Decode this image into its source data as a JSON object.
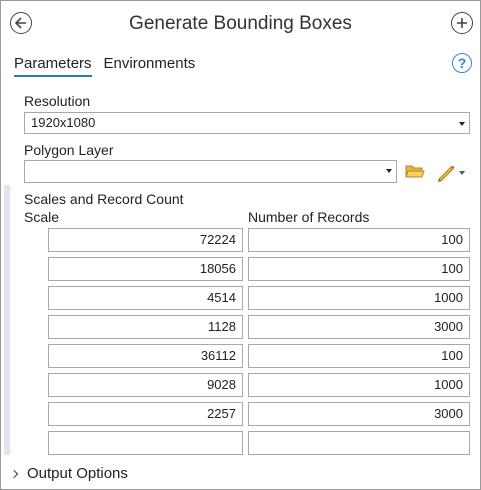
{
  "header": {
    "title": "Generate Bounding Boxes",
    "back_icon": "back-arrow-icon",
    "add_icon": "plus-icon"
  },
  "tabs": [
    {
      "label": "Parameters",
      "active": true
    },
    {
      "label": "Environments",
      "active": false
    }
  ],
  "help_icon": "?",
  "resolution": {
    "label": "Resolution",
    "value": "1920x1080"
  },
  "polygon_layer": {
    "label": "Polygon Layer",
    "value": ""
  },
  "table": {
    "title": "Scales and Record Count",
    "headers": [
      "Scale",
      "Number of Records"
    ],
    "rows": [
      [
        "72224",
        "100"
      ],
      [
        "18056",
        "100"
      ],
      [
        "4514",
        "1000"
      ],
      [
        "1128",
        "3000"
      ],
      [
        "36112",
        "100"
      ],
      [
        "9028",
        "1000"
      ],
      [
        "2257",
        "3000"
      ],
      [
        "",
        ""
      ]
    ]
  },
  "output_options": {
    "label": "Output Options"
  },
  "colors": {
    "accent": "#2a7ac0",
    "help": "#2f86d6",
    "folder": "#e7b53a"
  }
}
